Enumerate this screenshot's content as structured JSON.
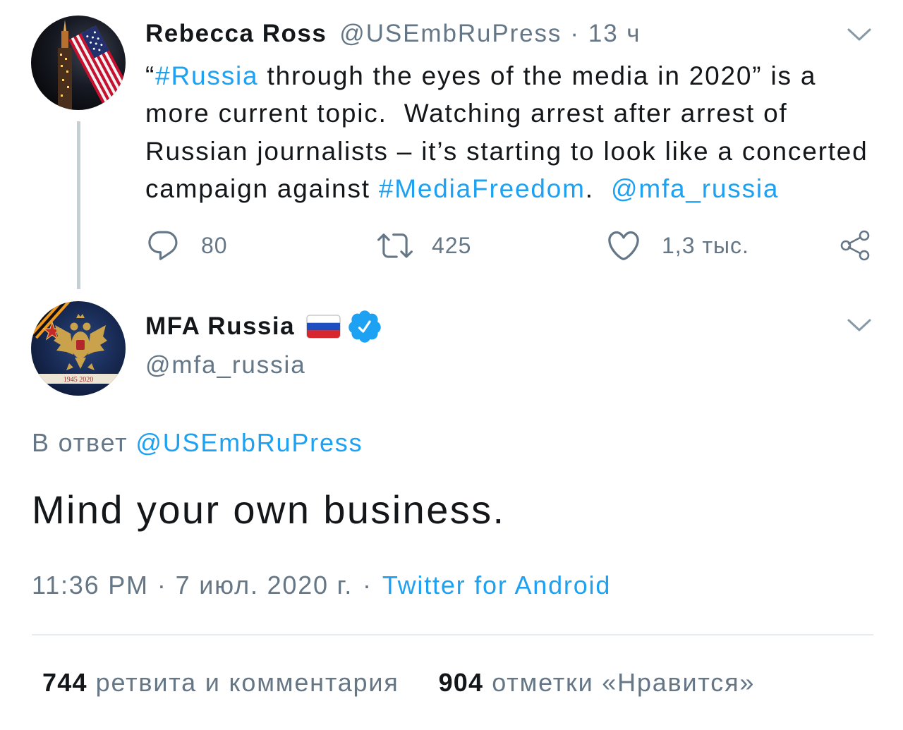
{
  "colors": {
    "text": "#14171a",
    "secondary": "#657786",
    "link": "#1da1f2",
    "divider": "#e6ecf0",
    "thread": "#c4cfd6",
    "verified": "#1da1f2",
    "icon": "#657786",
    "chevron": "#8899a6"
  },
  "parent_tweet": {
    "author_name": "Rebecca Ross",
    "handle": "@USEmbRuPress",
    "separator": "·",
    "time": "13 ч",
    "avatar_icon": "profile-photo-us-flag-icon",
    "menu_icon": "chevron-down-icon",
    "text_lines": [
      [
        "“",
        "#Russia",
        " through the eyes of the media in 2020” is a"
      ],
      [
        "more current topic.  Watching arrest after arrest of"
      ],
      [
        "Russian journalists – it’s starting to look like a concerted"
      ],
      [
        "campaign against ",
        "#MediaFreedom",
        ".  ",
        "@mfa_russia"
      ]
    ],
    "actions": {
      "reply": {
        "icon": "reply-icon",
        "count": "80"
      },
      "retweet": {
        "icon": "retweet-icon",
        "count": "425"
      },
      "like": {
        "icon": "heart-icon",
        "count": "1,3 тыс."
      },
      "share": {
        "icon": "share-icon"
      }
    }
  },
  "main_tweet": {
    "author_name": "MFA Russia",
    "handle": "@mfa_russia",
    "flag_icon": "russia-flag-icon",
    "verified_icon": "verified-badge-icon",
    "avatar_icon": "profile-emblem-double-headed-eagle-icon",
    "avatar_lettering": "1945 2020",
    "menu_icon": "chevron-down-icon",
    "reply_prefix": "В ответ",
    "reply_to": "@USEmbRuPress",
    "text": "Mind your own business.",
    "time": "11:36 PM",
    "separator": "·",
    "date": "7 июл. 2020 г.",
    "source": "Twitter for Android",
    "stats": {
      "retweets_count": "744",
      "retweets_label": "ретвита и комментария",
      "likes_count": "904",
      "likes_label": "отметки «Нравится»"
    }
  }
}
